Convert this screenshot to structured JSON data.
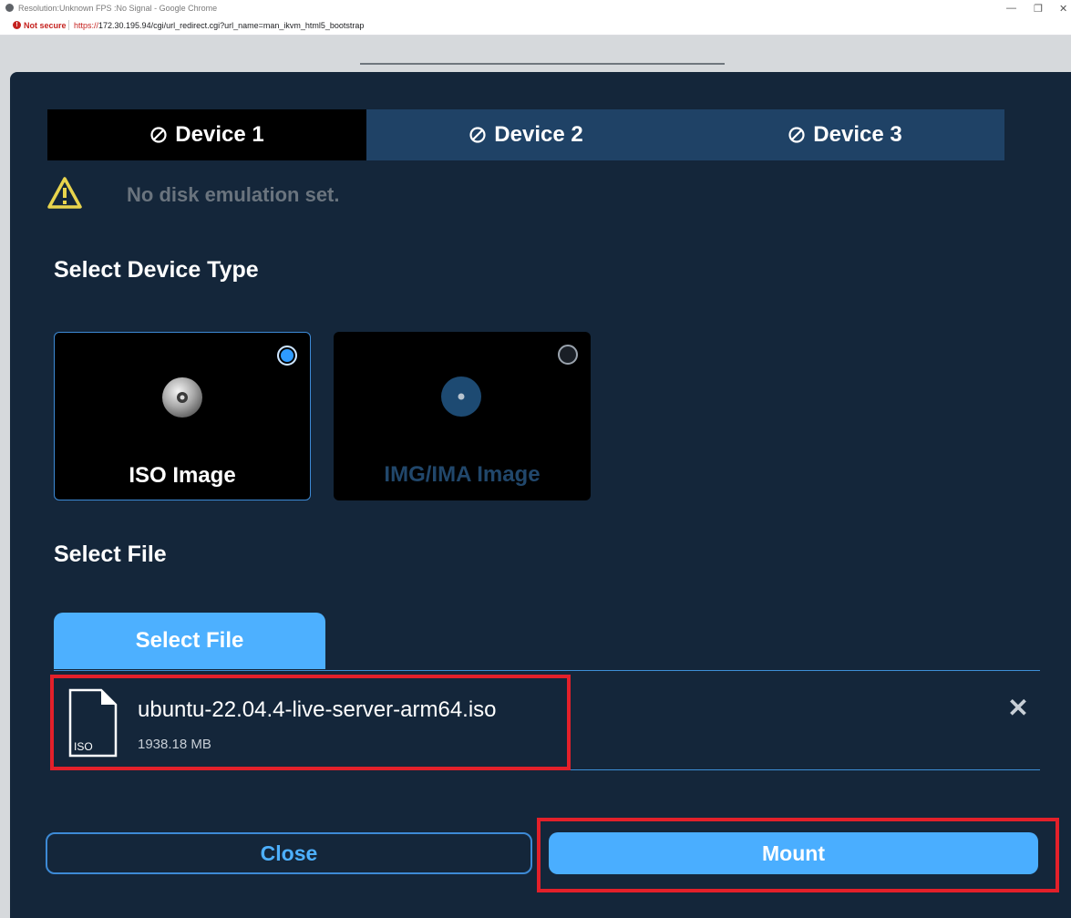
{
  "browser": {
    "window_title": "Resolution:Unknown FPS :No Signal - Google Chrome",
    "security_label": "Not secure",
    "url_scheme": "https://",
    "url_rest": "172.30.195.94/cgi/url_redirect.cgi?url_name=man_ikvm_html5_bootstrap",
    "controls": {
      "minimize": "—",
      "restore": "❐",
      "close": "✕"
    }
  },
  "tabs": [
    {
      "label": "Device 1",
      "icon": "disabled-circle-icon",
      "active": true
    },
    {
      "label": "Device 2",
      "icon": "disabled-circle-icon",
      "active": false
    },
    {
      "label": "Device 3",
      "icon": "disabled-circle-icon",
      "active": false
    }
  ],
  "status": {
    "icon": "warning-triangle-icon",
    "message": "No disk emulation set."
  },
  "device_type": {
    "heading": "Select Device Type",
    "options": [
      {
        "label": "ISO Image",
        "icon": "cd-disc-icon",
        "selected": true,
        "enabled": true
      },
      {
        "label": "IMG/IMA Image",
        "icon": "disc-icon",
        "selected": false,
        "enabled": false
      }
    ]
  },
  "file_select": {
    "heading": "Select File",
    "button_label": "Select File",
    "file": {
      "name": "ubuntu-22.04.4-live-server-arm64.iso",
      "size": "1938.18 MB",
      "type_badge": "ISO",
      "remove_label": "✕"
    }
  },
  "footer": {
    "close_label": "Close",
    "mount_label": "Mount"
  },
  "colors": {
    "modal_bg": "#14263a",
    "tab_active": "#000000",
    "tab_inactive": "#1f4266",
    "accent": "#4aaeff",
    "warning": "#e8d44d",
    "highlight": "#e3202a"
  }
}
